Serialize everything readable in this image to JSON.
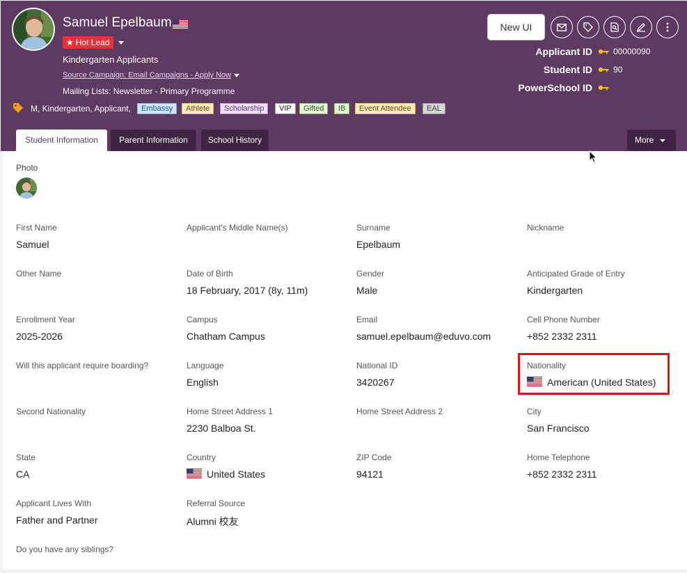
{
  "profile": {
    "name": "Samuel Epelbaum",
    "lead_badge": "Hot Lead",
    "group": "Kindergarten Applicants",
    "campaign": "Source Campaign: Email Campaigns - Apply Now",
    "mailing_lists": "Mailing Lists: Newsletter - Primary Programme",
    "tags_text": "M, Kindergarten, Applicant,",
    "tag_chips": [
      "Embassy",
      "Athlete",
      "Scholarship",
      "VIP",
      "Gifted",
      "IB",
      "Event Attendee",
      "EAL"
    ]
  },
  "toolbar": {
    "new_ui": "New UI",
    "icons": [
      "mail-icon",
      "tag-icon",
      "search-doc-icon",
      "edit-icon",
      "more-vertical-icon"
    ]
  },
  "ids": {
    "applicant_label": "Applicant ID",
    "applicant_value": "00000090",
    "student_label": "Student ID",
    "student_value": "90",
    "powerschool_label": "PowerSchool ID",
    "powerschool_value": ""
  },
  "tabs": [
    "Student Information",
    "Parent Information",
    "School History"
  ],
  "more_label": "More",
  "photo_label": "Photo",
  "fields": {
    "first_name": {
      "label": "First Name",
      "value": "Samuel"
    },
    "middle_name": {
      "label": "Applicant's Middle Name(s)",
      "value": ""
    },
    "surname": {
      "label": "Surname",
      "value": "Epelbaum"
    },
    "nickname": {
      "label": "Nickname",
      "value": ""
    },
    "other_name": {
      "label": "Other Name",
      "value": ""
    },
    "dob": {
      "label": "Date of Birth",
      "value": "18 February, 2017 (8y, 11m)"
    },
    "gender": {
      "label": "Gender",
      "value": "Male"
    },
    "grade": {
      "label": "Anticipated Grade of Entry",
      "value": "Kindergarten"
    },
    "enrollment": {
      "label": "Enrollment Year",
      "value": "2025-2026"
    },
    "campus": {
      "label": "Campus",
      "value": "Chatham Campus"
    },
    "email": {
      "label": "Email",
      "value": "samuel.epelbaum@eduvo.com"
    },
    "cell": {
      "label": "Cell Phone Number",
      "value": "+852 2332 2311"
    },
    "boarding": {
      "label": "Will this applicant require boarding?",
      "value": ""
    },
    "language": {
      "label": "Language",
      "value": "English"
    },
    "national_id": {
      "label": "National ID",
      "value": "3420267"
    },
    "nationality": {
      "label": "Nationality",
      "value": "American (United States)"
    },
    "second_nationality": {
      "label": "Second Nationality",
      "value": ""
    },
    "address1": {
      "label": "Home Street Address 1",
      "value": "2230 Balboa St."
    },
    "address2": {
      "label": "Home Street Address 2",
      "value": ""
    },
    "city": {
      "label": "City",
      "value": "San Francisco"
    },
    "state": {
      "label": "State",
      "value": "CA"
    },
    "country": {
      "label": "Country",
      "value": "United States"
    },
    "zip": {
      "label": "ZIP Code",
      "value": "94121"
    },
    "home_tel": {
      "label": "Home Telephone",
      "value": "+852 2332 2311"
    },
    "lives_with": {
      "label": "Applicant Lives With",
      "value": "Father and Partner"
    },
    "referral": {
      "label": "Referral Source",
      "value": "Alumni 校友"
    },
    "siblings": {
      "label": "Do you have any siblings?",
      "value": ""
    }
  },
  "colors": {
    "header_bg": "#5e3a62",
    "tab_dark": "#3f2444",
    "hot_lead": "#e8313a",
    "highlight": "#d9151c",
    "key_icon": "#f2c200"
  }
}
